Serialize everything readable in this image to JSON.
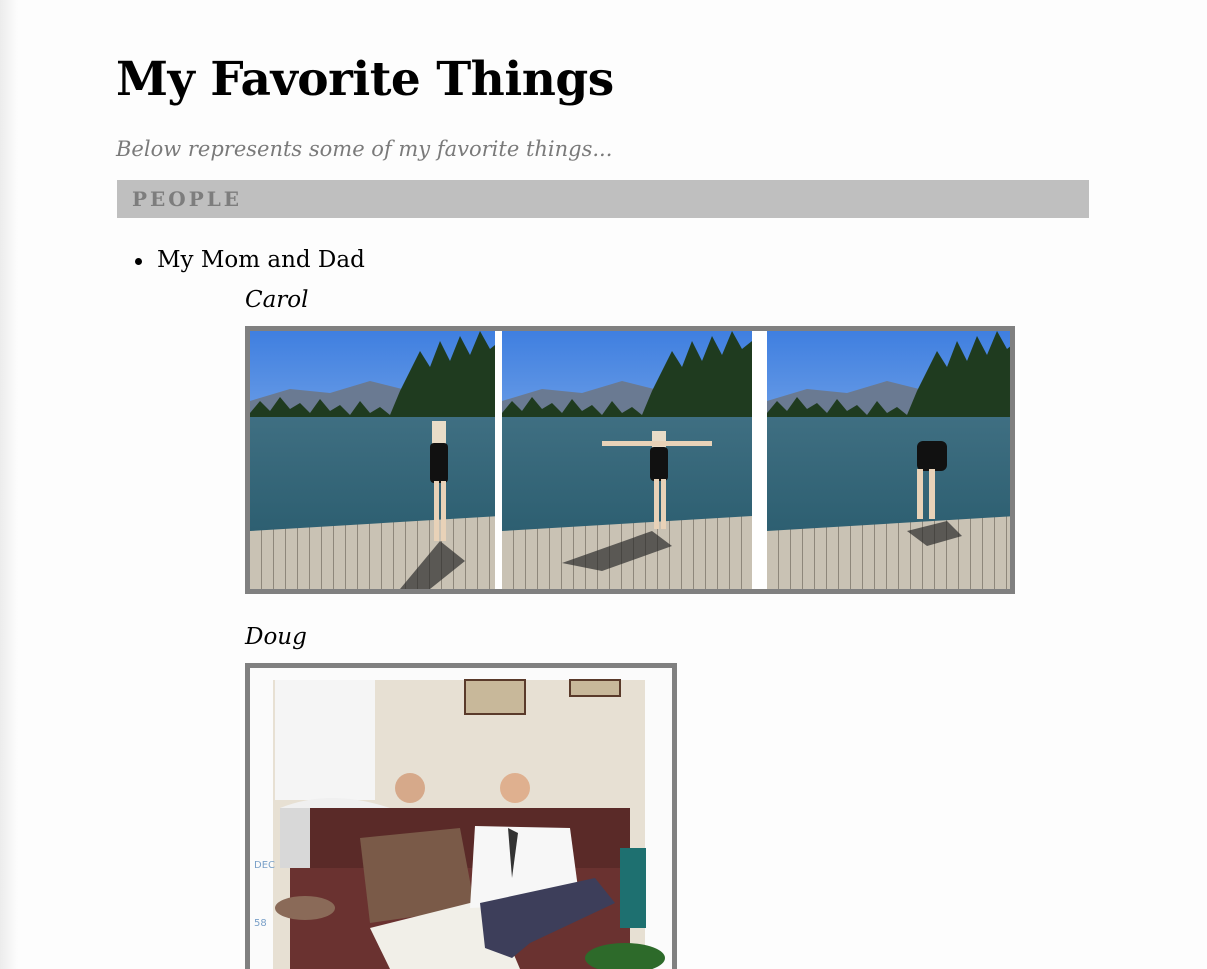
{
  "page": {
    "title": "My Favorite Things",
    "subtitle": "Below represents some of my favorite things..."
  },
  "section": {
    "heading": "PEOPLE"
  },
  "list": {
    "items": [
      {
        "label": "My Mom and Dad",
        "people": [
          {
            "name": "Carol",
            "photo_icon": "dock-diving-photo-strip"
          },
          {
            "name": "Doug",
            "photo_icon": "vintage-couch-photo"
          }
        ]
      }
    ]
  },
  "colors": {
    "section_bar": "#bfbfbf",
    "section_text": "#7d7d7d",
    "subtitle": "#7a7a7a",
    "photo_border": "#808080"
  }
}
